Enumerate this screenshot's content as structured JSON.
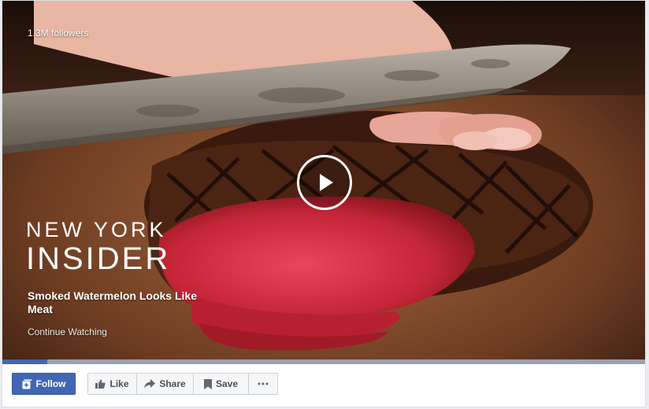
{
  "video": {
    "followers": "1.3M followers",
    "brand_line1": "NEW YORK",
    "brand_line2": "INSIDER",
    "title": "Smoked Watermelon Looks Like Meat",
    "continue_label": "Continue Watching",
    "progress_fraction": 0.07,
    "progress_color": "#4267b2"
  },
  "actions": {
    "follow_label": "Follow",
    "like_label": "Like",
    "share_label": "Share",
    "save_label": "Save",
    "more_icon": "more-icon"
  }
}
